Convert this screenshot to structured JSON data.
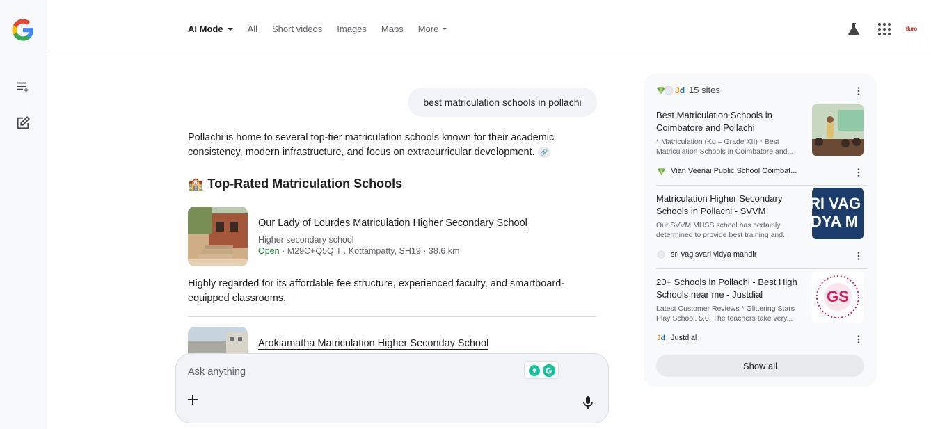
{
  "nav": {
    "tabs": [
      {
        "label": "AI Mode"
      },
      {
        "label": "All"
      },
      {
        "label": "Short videos"
      },
      {
        "label": "Images"
      },
      {
        "label": "Maps"
      },
      {
        "label": "More"
      }
    ]
  },
  "profile": {
    "label": "tluro"
  },
  "conversation": {
    "query": "best matriculation schools in pollachi",
    "intro": "Pollachi is home to several top-tier matriculation schools known for their academic consistency, modern infrastructure, and focus on extracurricular development.",
    "heading_emoji": "🏫",
    "heading": "Top-Rated Matriculation Schools",
    "schools": [
      {
        "name": "Our Lady of Lourdes Matriculation Higher Secondary School",
        "type": "Higher secondary school",
        "status": "Open",
        "details": " · M29C+Q5Q T . Kottampatty, SH19 · 38.6 km",
        "description": "Highly regarded for its affordable fee structure, experienced faculty, and smartboard-equipped classrooms."
      },
      {
        "name": "Arokiamatha Matriculation Higher Seconday School"
      }
    ]
  },
  "ask": {
    "placeholder": "Ask anything"
  },
  "sources": {
    "count_label": "15 sites",
    "cards": [
      {
        "title": "Best Matriculation Schools in Coimbatore and Pollachi",
        "snippet": "* Matriculation (Kg – Grade XII) * Best Matriculation Schools in Coimbatore and...",
        "source": "Vian Veenai Public School Coimbat..."
      },
      {
        "title": "Matriculation Higher Secondary Schools in Pollachi - SVVM",
        "snippet": "Our SVVM MHSS school has certainly determined to provide best training and...",
        "source": "sri vagisvari vidya mandir",
        "image_text_1": "RI VAG",
        "image_text_2": "DYA M"
      },
      {
        "title": "20+ Schools in Pollachi - Best High Schools near me - Justdial",
        "snippet": "Latest Customer Reviews * Glittering Stars Play School. 5.0. The teachers take very...",
        "source": "Justdial",
        "image_text": "GS"
      }
    ],
    "show_all_label": "Show all"
  },
  "colors": {
    "accent_open": "#188038",
    "rail_bg": "#f8f9fa",
    "panel_bg": "#f8f9fa",
    "svvm_blue": "#1c3d6b"
  }
}
